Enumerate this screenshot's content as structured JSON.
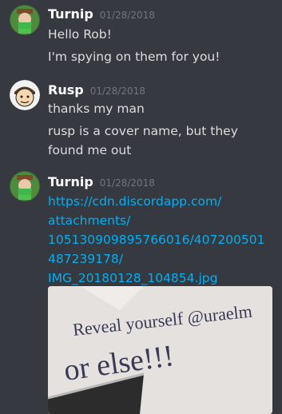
{
  "messages": [
    {
      "username": "Turnip",
      "timestamp": "01/28/2018",
      "lines": [
        "Hello Rob!",
        "I'm spying on them for you!"
      ]
    },
    {
      "username": "Rusp",
      "timestamp": "01/28/2018",
      "lines": [
        "thanks my man",
        "rusp is a cover name, but they found me out"
      ]
    },
    {
      "username": "Turnip",
      "timestamp": "01/28/2018",
      "link_lines": [
        "https://cdn.discordapp.com/",
        "attachments/",
        "105130909895766016/407200501",
        "487239178/",
        "IMG_20180128_104854.jpg"
      ],
      "attachment": {
        "note_line1": "Reveal yourself @uraelm",
        "note_line2": "or else!!!"
      }
    }
  ],
  "colors": {
    "background": "#36393f",
    "username": "#ffffff",
    "timestamp": "#72767d",
    "text": "#dcddde",
    "link": "#00b0f4"
  }
}
